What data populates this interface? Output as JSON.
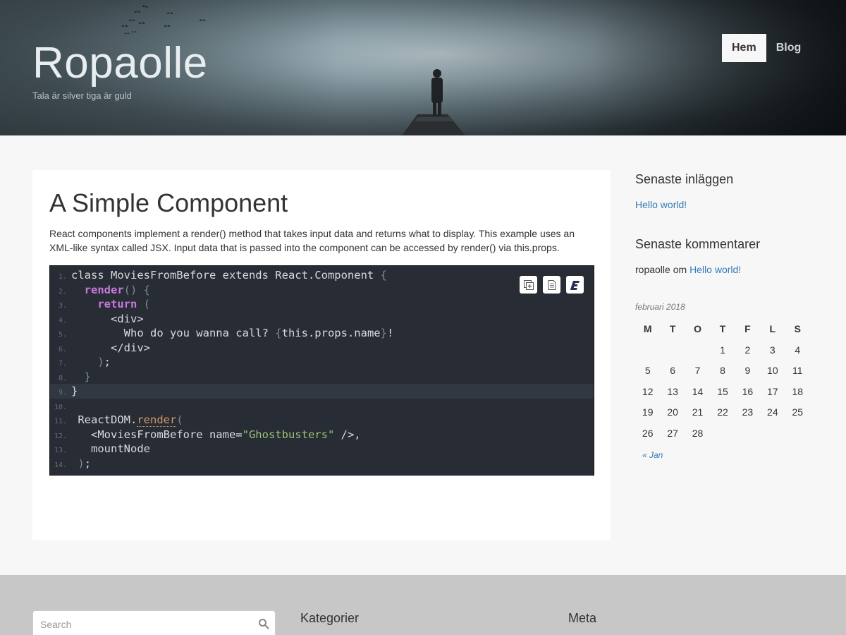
{
  "header": {
    "site_title": "Ropaolle",
    "tagline": "Tala är silver tiga är guld",
    "nav": [
      {
        "label": "Hem",
        "active": true
      },
      {
        "label": "Blog",
        "active": false
      }
    ]
  },
  "post": {
    "title": "A Simple Component",
    "body": "React components implement a render() method that takes input data and returns what to display. This example uses an XML-like syntax called JSX. Input data that is passed into the component can be accessed by render() via this.props.",
    "code": {
      "highlighted_line": 9,
      "lines": [
        "1.",
        "2.",
        "3.",
        "4.",
        "5.",
        "6.",
        "7.",
        "8.",
        "9.",
        "10.",
        "11.",
        "12.",
        "13.",
        "14."
      ],
      "tokens": {
        "l1_a": "class MoviesFromBefore extends React.Component ",
        "l1_b": "{",
        "l2_a": "render",
        "l2_b": "() {",
        "l3_a": "return",
        "l3_b": " (",
        "l4": "<div>",
        "l5_a": "Who do you wanna call? ",
        "l5_b": "{",
        "l5_c": "this.props.name",
        "l5_d": "}",
        "l5_e": "!",
        "l6": "</div>",
        "l7_a": ")",
        "l7_b": ";",
        "l8": "}",
        "l9": "}",
        "l11_a": "ReactDOM.",
        "l11_b": "render",
        "l11_c": "(",
        "l12_a": "<MoviesFromBefore name=",
        "l12_b": "\"Ghostbusters\"",
        "l12_c": " />,",
        "l13": "mountNode",
        "l14_a": ")",
        "l14_b": ";"
      },
      "tools": [
        "copy-icon",
        "document-icon",
        "e-icon"
      ]
    }
  },
  "sidebar": {
    "recent_posts_title": "Senaste inläggen",
    "recent_posts": [
      "Hello world!"
    ],
    "recent_comments_title": "Senaste kommentarer",
    "comment_author": "ropaolle",
    "comment_om": " om ",
    "comment_link": "Hello world!",
    "calendar": {
      "caption": "februari 2018",
      "weekdays": [
        "M",
        "T",
        "O",
        "T",
        "F",
        "L",
        "S"
      ],
      "weeks": [
        [
          "",
          "",
          "",
          "1",
          "2",
          "3",
          "4"
        ],
        [
          "5",
          "6",
          "7",
          "8",
          "9",
          "10",
          "11"
        ],
        [
          "12",
          "13",
          "14",
          "15",
          "16",
          "17",
          "18"
        ],
        [
          "19",
          "20",
          "21",
          "22",
          "23",
          "24",
          "25"
        ],
        [
          "26",
          "27",
          "28",
          "",
          "",
          "",
          ""
        ]
      ],
      "prev": "« Jan"
    }
  },
  "footer": {
    "search_placeholder": "Search",
    "categories_title": "Kategorier",
    "meta_title": "Meta"
  },
  "colors": {
    "link": "#337ab7",
    "code_bg": "#282c34",
    "footer_bg": "#c7c7c7"
  }
}
